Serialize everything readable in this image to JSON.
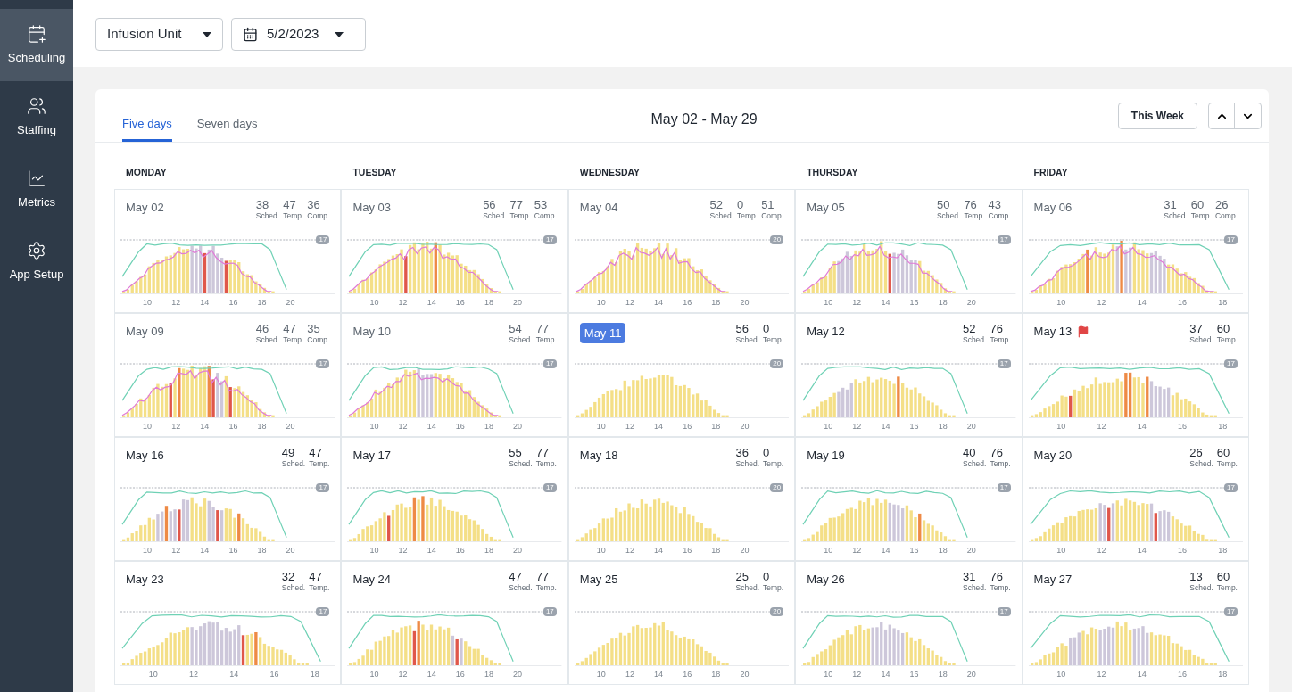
{
  "sidebar": {
    "items": [
      {
        "label": "Scheduling",
        "selected": true
      },
      {
        "label": "Staffing",
        "selected": false
      },
      {
        "label": "Metrics",
        "selected": false
      },
      {
        "label": "App Setup",
        "selected": false
      }
    ]
  },
  "toolbar": {
    "unit": "Infusion Unit",
    "date": "5/2/2023"
  },
  "calendar": {
    "tabs": [
      {
        "label": "Five days",
        "selected": true
      },
      {
        "label": "Seven days",
        "selected": false
      }
    ],
    "range": "May 02 - May 29",
    "this_week": "This Week",
    "weekdays": [
      "MONDAY",
      "TUESDAY",
      "WEDNESDAY",
      "THURSDAY",
      "FRIDAY"
    ],
    "days": [
      {
        "date": "May 02",
        "past": true,
        "today": false,
        "flagged": false,
        "limit": "17",
        "stats": [
          {
            "value": "38",
            "label": "Sched."
          },
          {
            "value": "47",
            "label": "Temp."
          },
          {
            "value": "36",
            "label": "Comp."
          }
        ],
        "ticks": [
          "10",
          "12",
          "14",
          "16",
          "18",
          "20"
        ]
      },
      {
        "date": "May 03",
        "past": true,
        "today": false,
        "flagged": false,
        "limit": "17",
        "stats": [
          {
            "value": "56",
            "label": "Sched."
          },
          {
            "value": "77",
            "label": "Temp."
          },
          {
            "value": "53",
            "label": "Comp."
          }
        ],
        "ticks": [
          "10",
          "12",
          "14",
          "16",
          "18",
          "20"
        ]
      },
      {
        "date": "May 04",
        "past": true,
        "today": false,
        "flagged": false,
        "limit": "20",
        "stats": [
          {
            "value": "52",
            "label": "Sched."
          },
          {
            "value": "0",
            "label": "Temp."
          },
          {
            "value": "51",
            "label": "Comp."
          }
        ],
        "ticks": [
          "10",
          "12",
          "14",
          "16",
          "18",
          "20"
        ]
      },
      {
        "date": "May 05",
        "past": true,
        "today": false,
        "flagged": false,
        "limit": "17",
        "stats": [
          {
            "value": "50",
            "label": "Sched."
          },
          {
            "value": "76",
            "label": "Temp."
          },
          {
            "value": "43",
            "label": "Comp."
          }
        ],
        "ticks": [
          "10",
          "12",
          "14",
          "16",
          "18",
          "20"
        ]
      },
      {
        "date": "May 06",
        "past": true,
        "today": false,
        "flagged": false,
        "limit": "17",
        "stats": [
          {
            "value": "31",
            "label": "Sched."
          },
          {
            "value": "60",
            "label": "Temp."
          },
          {
            "value": "26",
            "label": "Comp."
          }
        ],
        "ticks": [
          "10",
          "12",
          "14",
          "16",
          "18"
        ]
      },
      {
        "date": "May 09",
        "past": true,
        "today": false,
        "flagged": false,
        "limit": "17",
        "stats": [
          {
            "value": "46",
            "label": "Sched."
          },
          {
            "value": "47",
            "label": "Temp."
          },
          {
            "value": "35",
            "label": "Comp."
          }
        ],
        "ticks": [
          "10",
          "12",
          "14",
          "16",
          "18",
          "20"
        ]
      },
      {
        "date": "May 10",
        "past": true,
        "today": false,
        "flagged": false,
        "limit": "17",
        "stats": [
          {
            "value": "54",
            "label": "Sched."
          },
          {
            "value": "77",
            "label": "Temp."
          }
        ],
        "ticks": [
          "10",
          "12",
          "14",
          "16",
          "18",
          "20"
        ]
      },
      {
        "date": "May 11",
        "past": false,
        "today": true,
        "flagged": false,
        "limit": "20",
        "stats": [
          {
            "value": "56",
            "label": "Sched."
          },
          {
            "value": "0",
            "label": "Temp."
          }
        ],
        "ticks": [
          "10",
          "12",
          "14",
          "16",
          "18",
          "20"
        ]
      },
      {
        "date": "May 12",
        "past": false,
        "today": false,
        "flagged": false,
        "limit": "17",
        "stats": [
          {
            "value": "52",
            "label": "Sched."
          },
          {
            "value": "76",
            "label": "Temp."
          }
        ],
        "ticks": [
          "10",
          "12",
          "14",
          "16",
          "18",
          "20"
        ]
      },
      {
        "date": "May 13",
        "past": false,
        "today": false,
        "flagged": true,
        "limit": "17",
        "stats": [
          {
            "value": "37",
            "label": "Sched."
          },
          {
            "value": "60",
            "label": "Temp."
          }
        ],
        "ticks": [
          "10",
          "12",
          "14",
          "16",
          "18"
        ]
      },
      {
        "date": "May 16",
        "past": false,
        "today": false,
        "flagged": false,
        "limit": "17",
        "stats": [
          {
            "value": "49",
            "label": "Sched."
          },
          {
            "value": "47",
            "label": "Temp."
          }
        ],
        "ticks": [
          "10",
          "12",
          "14",
          "16",
          "18",
          "20"
        ]
      },
      {
        "date": "May 17",
        "past": false,
        "today": false,
        "flagged": false,
        "limit": "17",
        "stats": [
          {
            "value": "55",
            "label": "Sched."
          },
          {
            "value": "77",
            "label": "Temp."
          }
        ],
        "ticks": [
          "10",
          "12",
          "14",
          "16",
          "18",
          "20"
        ]
      },
      {
        "date": "May 18",
        "past": false,
        "today": false,
        "flagged": false,
        "limit": "20",
        "stats": [
          {
            "value": "36",
            "label": "Sched."
          },
          {
            "value": "0",
            "label": "Temp."
          }
        ],
        "ticks": [
          "10",
          "12",
          "14",
          "16",
          "18",
          "20"
        ]
      },
      {
        "date": "May 19",
        "past": false,
        "today": false,
        "flagged": false,
        "limit": "17",
        "stats": [
          {
            "value": "40",
            "label": "Sched."
          },
          {
            "value": "76",
            "label": "Temp."
          }
        ],
        "ticks": [
          "10",
          "12",
          "14",
          "16",
          "18",
          "20"
        ]
      },
      {
        "date": "May 20",
        "past": false,
        "today": false,
        "flagged": false,
        "limit": "17",
        "stats": [
          {
            "value": "26",
            "label": "Sched."
          },
          {
            "value": "60",
            "label": "Temp."
          }
        ],
        "ticks": [
          "10",
          "12",
          "14",
          "16",
          "18"
        ]
      },
      {
        "date": "May 23",
        "past": false,
        "today": false,
        "flagged": false,
        "limit": "17",
        "stats": [
          {
            "value": "32",
            "label": "Sched."
          },
          {
            "value": "47",
            "label": "Temp."
          }
        ],
        "ticks": [
          "10",
          "12",
          "14",
          "16",
          "18"
        ]
      },
      {
        "date": "May 24",
        "past": false,
        "today": false,
        "flagged": false,
        "limit": "17",
        "stats": [
          {
            "value": "47",
            "label": "Sched."
          },
          {
            "value": "77",
            "label": "Temp."
          }
        ],
        "ticks": [
          "10",
          "12",
          "14",
          "16",
          "18",
          "20"
        ]
      },
      {
        "date": "May 25",
        "past": false,
        "today": false,
        "flagged": false,
        "limit": "20",
        "stats": [
          {
            "value": "25",
            "label": "Sched."
          },
          {
            "value": "0",
            "label": "Temp."
          }
        ],
        "ticks": [
          "10",
          "12",
          "14",
          "16",
          "18",
          "20"
        ]
      },
      {
        "date": "May 26",
        "past": false,
        "today": false,
        "flagged": false,
        "limit": "17",
        "stats": [
          {
            "value": "31",
            "label": "Sched."
          },
          {
            "value": "76",
            "label": "Temp."
          }
        ],
        "ticks": [
          "10",
          "12",
          "14",
          "16",
          "18",
          "20"
        ]
      },
      {
        "date": "May 27",
        "past": false,
        "today": false,
        "flagged": false,
        "limit": "17",
        "stats": [
          {
            "value": "13",
            "label": "Sched."
          },
          {
            "value": "60",
            "label": "Temp."
          }
        ],
        "ticks": [
          "10",
          "12",
          "14",
          "16",
          "18"
        ]
      }
    ]
  }
}
